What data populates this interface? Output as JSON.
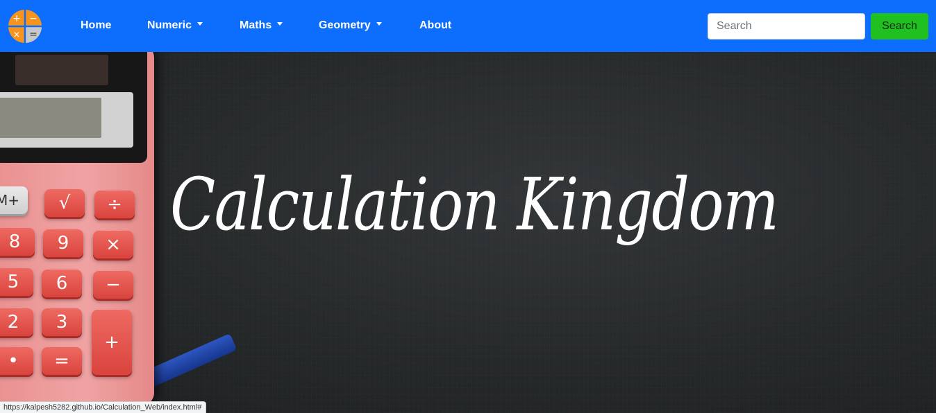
{
  "navbar": {
    "logo_icon": "calculator-symbols-logo-icon",
    "logo_symbols": [
      "+",
      "−",
      "×",
      "="
    ],
    "items": [
      {
        "label": "Home",
        "dropdown": false
      },
      {
        "label": "Numeric",
        "dropdown": true
      },
      {
        "label": "Maths",
        "dropdown": true
      },
      {
        "label": "Geometry",
        "dropdown": true
      },
      {
        "label": "About",
        "dropdown": false
      }
    ],
    "search": {
      "placeholder": "Search",
      "button_label": "Search"
    }
  },
  "hero": {
    "title": "Calculation Kingdom",
    "calculator_keys": [
      "M+",
      "√",
      "÷",
      "8",
      "9",
      "×",
      "5",
      "6",
      "−",
      "2",
      "3",
      "+",
      "•",
      "="
    ]
  },
  "status_bar": {
    "url": "https://kalpesh5282.github.io/Calculation_Web/index.html#"
  },
  "colors": {
    "navbar": "#0d6efd",
    "search_button": "#20c020",
    "logo_orange": "#f7941d",
    "logo_grey": "#c8c8c8",
    "calculator_body": "#f0a3a3",
    "calculator_key": "#dd4a42"
  }
}
